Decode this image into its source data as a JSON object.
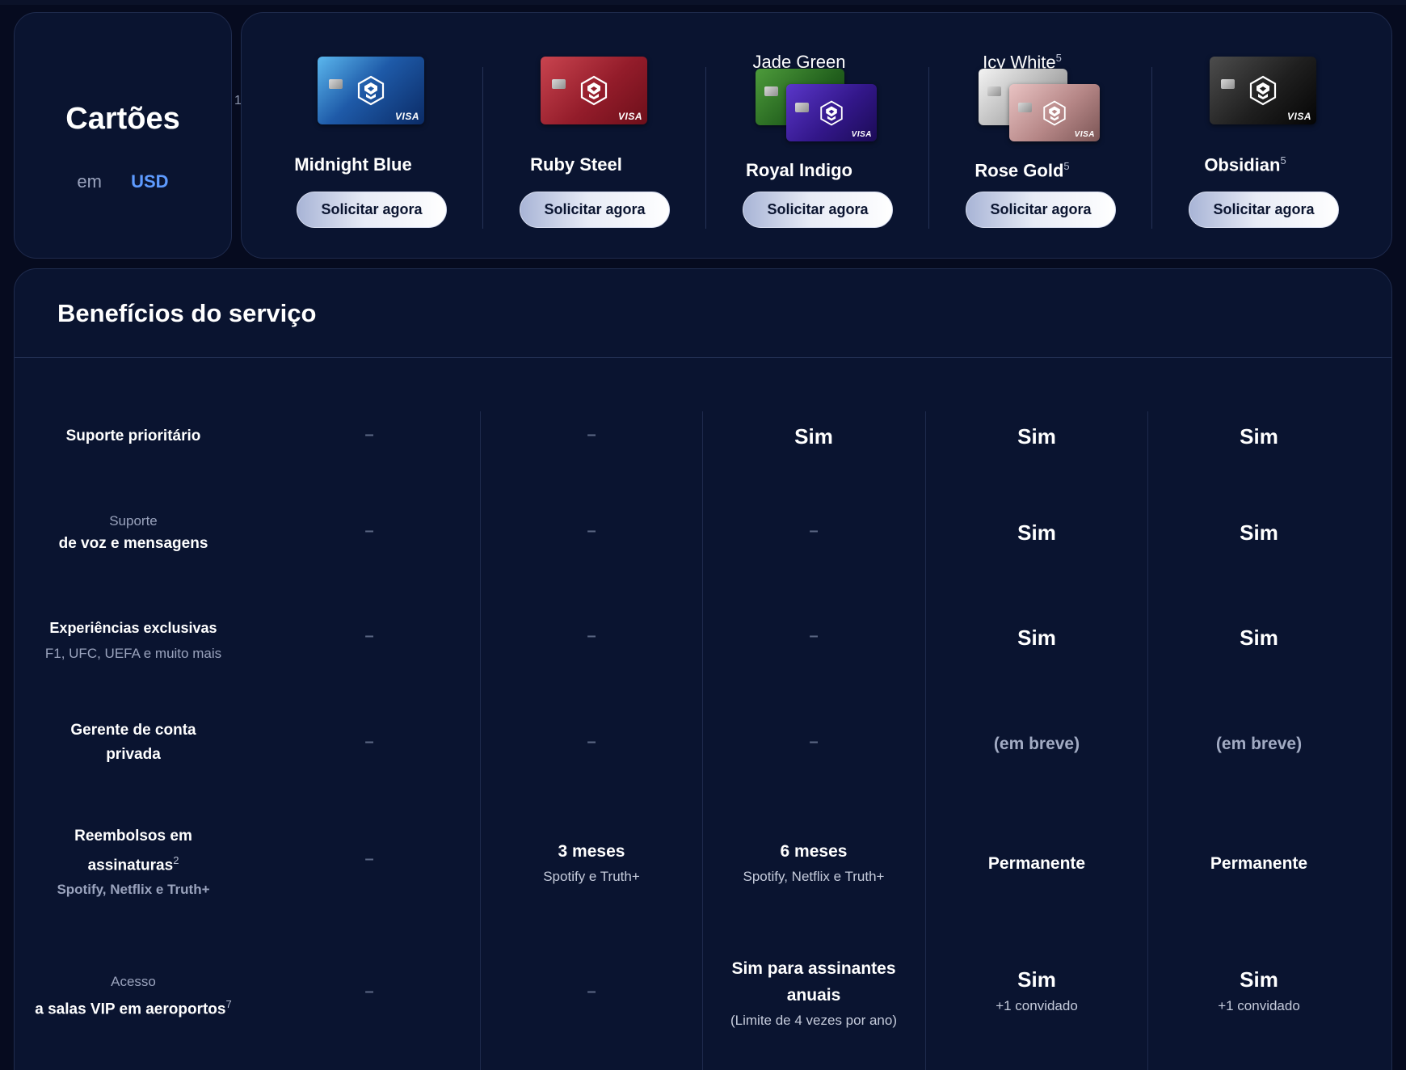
{
  "left_panel": {
    "title": "Cartões",
    "currency_prefix": "em",
    "currency": "USD",
    "footnote": "1"
  },
  "cards": [
    {
      "name": "Midnight Blue",
      "top_label": "",
      "name_sup": "",
      "top_sup": "",
      "cta": "Solicitar agora"
    },
    {
      "name": "Ruby Steel",
      "top_label": "",
      "name_sup": "",
      "top_sup": "",
      "cta": "Solicitar agora"
    },
    {
      "name": "Royal Indigo",
      "top_label": "Jade Green",
      "name_sup": "",
      "top_sup": "",
      "cta": "Solicitar agora"
    },
    {
      "name": "Rose Gold",
      "top_label": "Icy White",
      "name_sup": "5",
      "top_sup": "5",
      "cta": "Solicitar agora"
    },
    {
      "name": "Obsidian",
      "top_label": "",
      "name_sup": "5",
      "top_sup": "",
      "cta": "Solicitar agora"
    }
  ],
  "card_art": {
    "visa_text": "VISA",
    "colors": {
      "midnight_blue": "#1e5aa8",
      "ruby_steel": "#931c2a",
      "jade_green": "#22601d",
      "royal_indigo": "#33178a",
      "icy_white": "#b5b5b5",
      "rose_gold": "#b58686",
      "obsidian": "#1f1f1f"
    }
  },
  "benefits": {
    "title": "Benefícios do serviço",
    "rows": [
      {
        "label_top": "",
        "label_main": "Suporte prioritário",
        "label_sup": "",
        "label_sub": "",
        "cells": [
          {
            "main": "–",
            "sub": ""
          },
          {
            "main": "–",
            "sub": ""
          },
          {
            "main": "Sim",
            "sub": ""
          },
          {
            "main": "Sim",
            "sub": ""
          },
          {
            "main": "Sim",
            "sub": ""
          }
        ]
      },
      {
        "label_top": "Suporte",
        "label_main": "de voz e mensagens",
        "label_sup": "",
        "label_sub": "",
        "cells": [
          {
            "main": "–",
            "sub": ""
          },
          {
            "main": "–",
            "sub": ""
          },
          {
            "main": "–",
            "sub": ""
          },
          {
            "main": "Sim",
            "sub": ""
          },
          {
            "main": "Sim",
            "sub": ""
          }
        ]
      },
      {
        "label_top": "",
        "label_main": "Experiências exclusivas",
        "label_sup": "",
        "label_sub": "F1, UFC, UEFA e muito mais",
        "cells": [
          {
            "main": "–",
            "sub": ""
          },
          {
            "main": "–",
            "sub": ""
          },
          {
            "main": "–",
            "sub": ""
          },
          {
            "main": "Sim",
            "sub": ""
          },
          {
            "main": "Sim",
            "sub": ""
          }
        ]
      },
      {
        "label_top": "",
        "label_main": "Gerente de conta privada",
        "label_sup": "",
        "label_sub": "",
        "cells": [
          {
            "main": "–",
            "sub": ""
          },
          {
            "main": "–",
            "sub": ""
          },
          {
            "main": "–",
            "sub": ""
          },
          {
            "main": "(em breve)",
            "sub": ""
          },
          {
            "main": "(em breve)",
            "sub": ""
          }
        ]
      },
      {
        "label_top": "",
        "label_main": "Reembolsos em assinaturas",
        "label_sup": "2",
        "label_sub": "Spotify, Netflix e Truth+",
        "cells": [
          {
            "main": "–",
            "sub": ""
          },
          {
            "main": "3 meses",
            "sub": "Spotify e Truth+"
          },
          {
            "main": "6 meses",
            "sub": "Spotify, Netflix e Truth+"
          },
          {
            "main": "Permanente",
            "sub": ""
          },
          {
            "main": "Permanente",
            "sub": ""
          }
        ]
      },
      {
        "label_top": "Acesso",
        "label_main": "a salas VIP em aeroportos",
        "label_sup": "7",
        "label_sub": "",
        "cells": [
          {
            "main": "–",
            "sub": ""
          },
          {
            "main": "–",
            "sub": ""
          },
          {
            "main": "Sim para assinantes anuais",
            "sub": "(Limite de 4 vezes por ano)"
          },
          {
            "main": "Sim",
            "sub": "+1 convidado"
          },
          {
            "main": "Sim",
            "sub": "+1 convidado"
          }
        ]
      }
    ]
  }
}
